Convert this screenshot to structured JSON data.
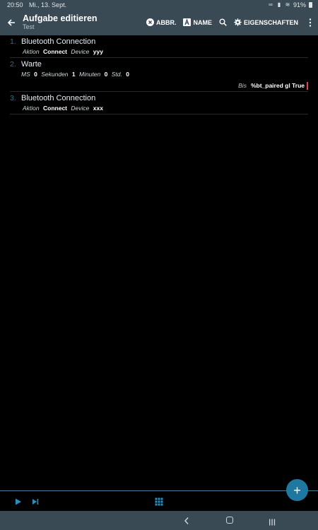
{
  "status_bar": {
    "time": "20:50",
    "date": "Mi., 13. Sept.",
    "battery": "91%"
  },
  "app_bar": {
    "title": "Aufgabe editieren",
    "subtitle": "Test",
    "actions": {
      "abbr": "ABBR.",
      "name": "NAME",
      "properties": "EIGENSCHAFTEN"
    }
  },
  "actions": [
    {
      "number": "1.",
      "name": "Bluetooth Connection",
      "params": [
        {
          "key": "Aktion",
          "value": "Connect"
        },
        {
          "key": "Device",
          "value": "yyy"
        }
      ]
    },
    {
      "number": "2.",
      "name": "Warte",
      "params": [
        {
          "key": "MS",
          "value": "0"
        },
        {
          "key": "Sekunden",
          "value": "1"
        },
        {
          "key": "Minuten",
          "value": "0"
        },
        {
          "key": "Std.",
          "value": "0"
        }
      ],
      "condition": {
        "key": "Bis",
        "value": "%bt_paired gl True"
      }
    },
    {
      "number": "3.",
      "name": "Bluetooth Connection",
      "params": [
        {
          "key": "Aktion",
          "value": "Connect"
        },
        {
          "key": "Device",
          "value": "xxx"
        }
      ]
    }
  ],
  "fab": {
    "label": "+"
  },
  "colors": {
    "bar": "#3a4a55",
    "accent": "#1f78a0",
    "number": "#2f6f8a",
    "condition_marker": "#e0434f"
  }
}
